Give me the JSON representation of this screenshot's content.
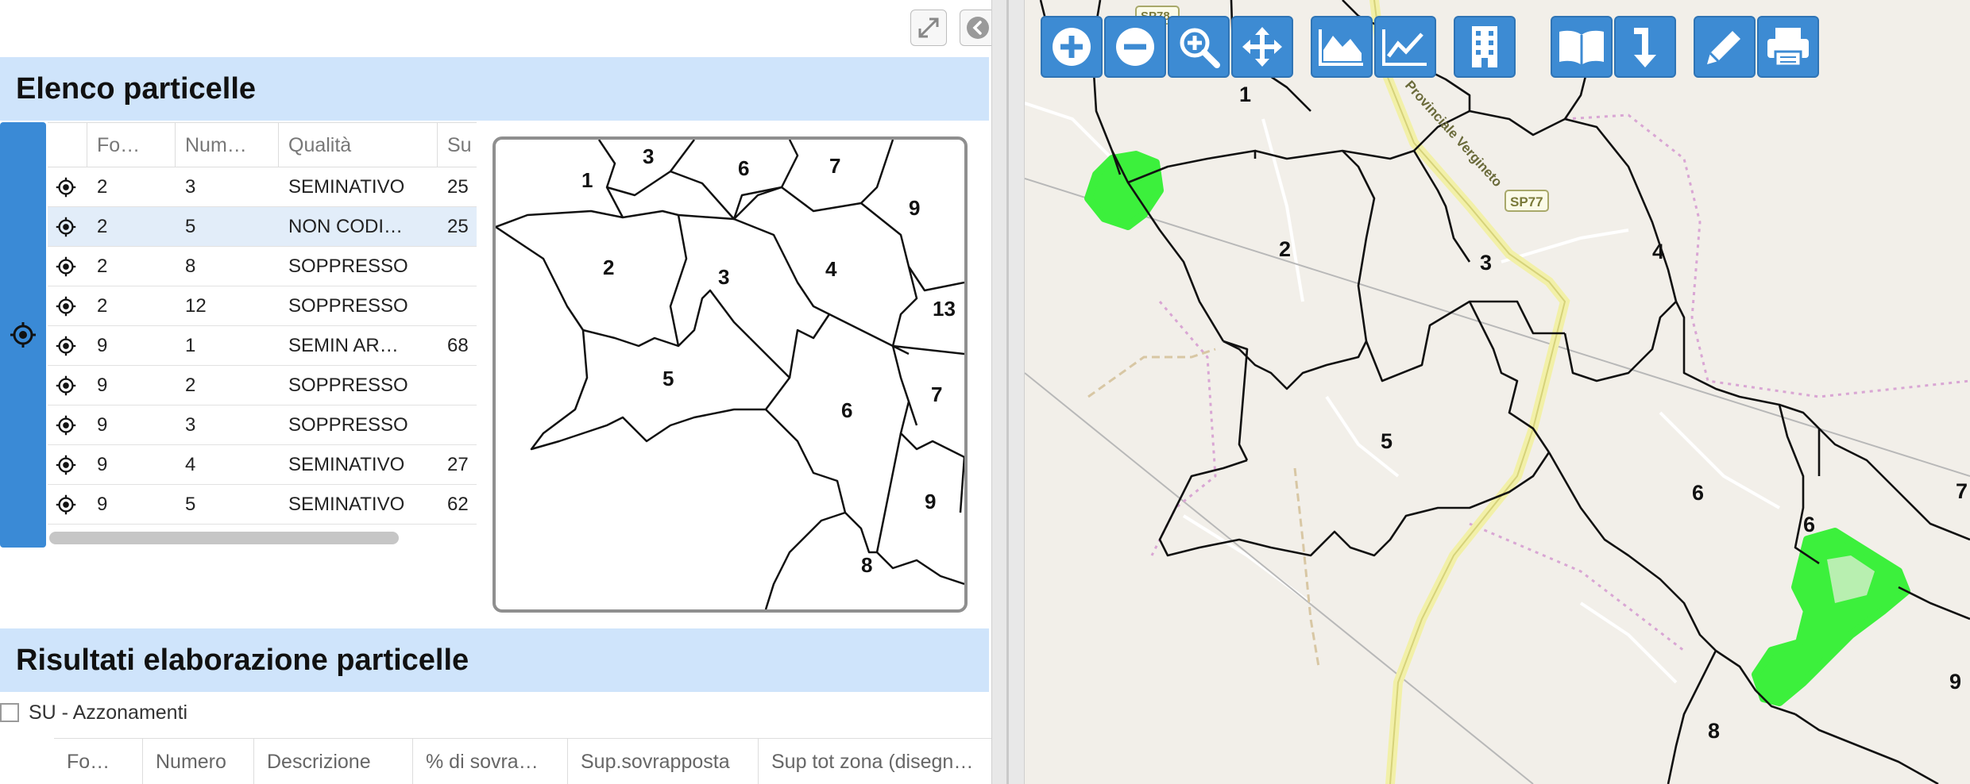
{
  "panel": {
    "expand_icon": "expand-arrows-icon",
    "collapse_icon": "chevron-left-circle-icon"
  },
  "elenco": {
    "title": "Elenco particelle",
    "columns": [
      "Fo…",
      "Num…",
      "Qualità",
      "Su"
    ],
    "rows": [
      {
        "foglio": "2",
        "numero": "3",
        "qualita": "SEMINATIVO",
        "sup": "25"
      },
      {
        "foglio": "2",
        "numero": "5",
        "qualita": "NON CODI…",
        "sup": "25"
      },
      {
        "foglio": "2",
        "numero": "8",
        "qualita": "SOPPRESSO",
        "sup": ""
      },
      {
        "foglio": "2",
        "numero": "12",
        "qualita": "SOPPRESSO",
        "sup": ""
      },
      {
        "foglio": "9",
        "numero": "1",
        "qualita": "SEMIN AR…",
        "sup": "68"
      },
      {
        "foglio": "9",
        "numero": "2",
        "qualita": "SOPPRESSO",
        "sup": ""
      },
      {
        "foglio": "9",
        "numero": "3",
        "qualita": "SOPPRESSO",
        "sup": ""
      },
      {
        "foglio": "9",
        "numero": "4",
        "qualita": "SEMINATIVO",
        "sup": "27"
      },
      {
        "foglio": "9",
        "numero": "5",
        "qualita": "SEMINATIVO",
        "sup": "62"
      }
    ],
    "selected_row": 1,
    "locate_icon": "target-icon"
  },
  "preview": {
    "labels": [
      "1",
      "3",
      "6",
      "7",
      "9",
      "2",
      "3",
      "4",
      "13",
      "5",
      "6",
      "7",
      "9",
      "8"
    ]
  },
  "risultati": {
    "title": "Risultati elaborazione particelle",
    "checkbox_label": "SU - Azzonamenti",
    "columns": [
      "Fo…",
      "Numero",
      "Descrizione",
      "% di sovra…",
      "Sup.sovrapposta",
      "Sup tot zona (disegn…"
    ]
  },
  "map": {
    "road_label": "SP77",
    "road_label_top": "SP78",
    "road_name": "Provinciale Vergineto",
    "parcel_labels": [
      "1",
      "2",
      "3",
      "4",
      "5",
      "6",
      "6",
      "7",
      "8",
      "9"
    ],
    "highlight_color": "#3cf03c",
    "toolbar_color": "#3d8bd3",
    "toolbar": [
      {
        "name": "zoom-in",
        "icon": "plus-icon"
      },
      {
        "name": "zoom-out",
        "icon": "minus-icon"
      },
      {
        "name": "zoom-box",
        "icon": "magnifier-plus-icon"
      },
      {
        "name": "pan",
        "icon": "move-arrows-icon"
      },
      {
        "name": "area-chart",
        "icon": "area-chart-icon"
      },
      {
        "name": "line-chart",
        "icon": "line-chart-icon"
      },
      {
        "name": "building",
        "icon": "building-icon"
      },
      {
        "name": "book",
        "icon": "open-book-icon"
      },
      {
        "name": "download",
        "icon": "arrow-down-icon"
      },
      {
        "name": "edit",
        "icon": "pencil-icon"
      },
      {
        "name": "print",
        "icon": "printer-icon"
      }
    ]
  }
}
